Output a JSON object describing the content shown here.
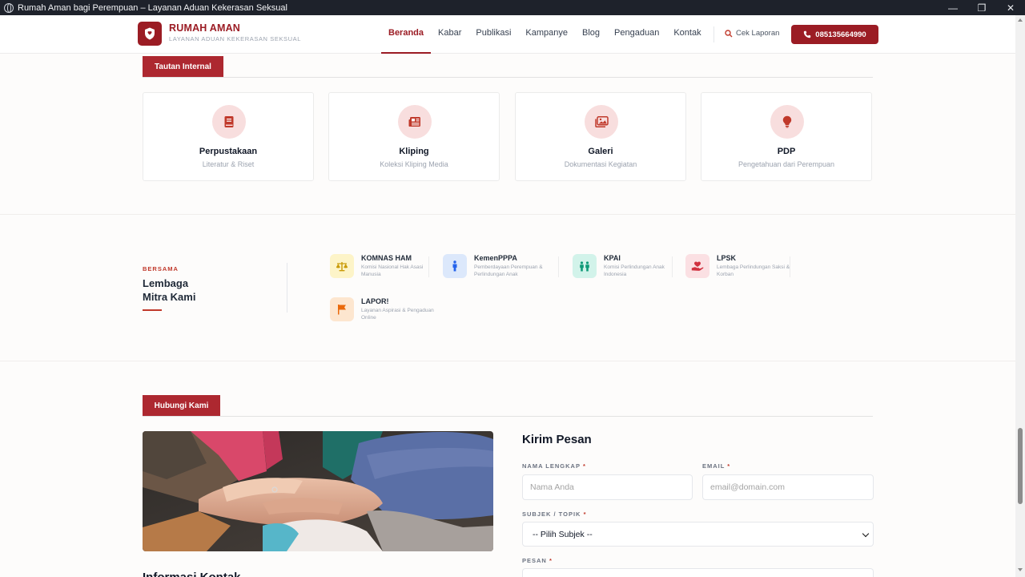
{
  "window": {
    "title": "Rumah Aman bagi Perempuan – Layanan Aduan Kekerasan Seksual",
    "minimize": "—",
    "restore": "❐",
    "close": "✕"
  },
  "brand": {
    "name": "RUMAH AMAN",
    "tagline": "LAYANAN ADUAN KEKERASAN SEKSUAL",
    "color": "#9b1c24"
  },
  "nav": {
    "items": [
      {
        "label": "Beranda"
      },
      {
        "label": "Kabar"
      },
      {
        "label": "Publikasi"
      },
      {
        "label": "Kampanye"
      },
      {
        "label": "Blog"
      },
      {
        "label": "Pengaduan"
      },
      {
        "label": "Kontak"
      }
    ],
    "active": "Beranda",
    "cek_laporan": "Cek Laporan",
    "phone": "085135664990"
  },
  "internal": {
    "tab": "Tautan Internal",
    "cards": [
      {
        "title": "Perpustakaan",
        "subtitle": "Literatur & Riset",
        "icon": "book-icon"
      },
      {
        "title": "Kliping",
        "subtitle": "Koleksi Kliping Media",
        "icon": "newspaper-icon"
      },
      {
        "title": "Galeri",
        "subtitle": "Dokumentasi Kegiatan",
        "icon": "images-icon"
      },
      {
        "title": "PDP",
        "subtitle": "Pengetahuan dari Perempuan",
        "icon": "lightbulb-icon"
      }
    ]
  },
  "partners": {
    "kicker": "BERSAMA",
    "title_line1": "Lembaga",
    "title_line2": "Mitra Kami",
    "items": [
      {
        "name": "KOMNAS HAM",
        "desc": "Komisi Nasional Hak Asasi Manusia",
        "icon": "scale-icon",
        "bg": "#fdf4c8",
        "fg": "#c99a06"
      },
      {
        "name": "KemenPPPA",
        "desc": "Pemberdayaan Perempuan & Perlindungan Anak",
        "icon": "person-icon",
        "bg": "#dce8fb",
        "fg": "#2563eb"
      },
      {
        "name": "KPAI",
        "desc": "Komisi Perlindungan Anak Indonesia",
        "icon": "children-icon",
        "bg": "#d2f3ea",
        "fg": "#0f9a78"
      },
      {
        "name": "LPSK",
        "desc": "Lembaga Perlindungan Saksi & Korban",
        "icon": "hand-heart-icon",
        "bg": "#fbe0e3",
        "fg": "#d0313f"
      },
      {
        "name": "LAPOR!",
        "desc": "Layanan Aspirasi & Pengaduan Online",
        "icon": "flag-icon",
        "bg": "#fde6cf",
        "fg": "#ea6a0c"
      }
    ]
  },
  "contact": {
    "tab": "Hubungi Kami",
    "form_title": "Kirim Pesan",
    "name_label": "NAMA LENGKAP",
    "name_placeholder": "Nama Anda",
    "email_label": "EMAIL",
    "email_placeholder": "email@domain.com",
    "subject_label": "SUBJEK / TOPIK",
    "subject_value": "-- Pilih Subjek --",
    "message_label": "PESAN",
    "required_mark": "*",
    "info_title": "Informasi Kontak"
  }
}
